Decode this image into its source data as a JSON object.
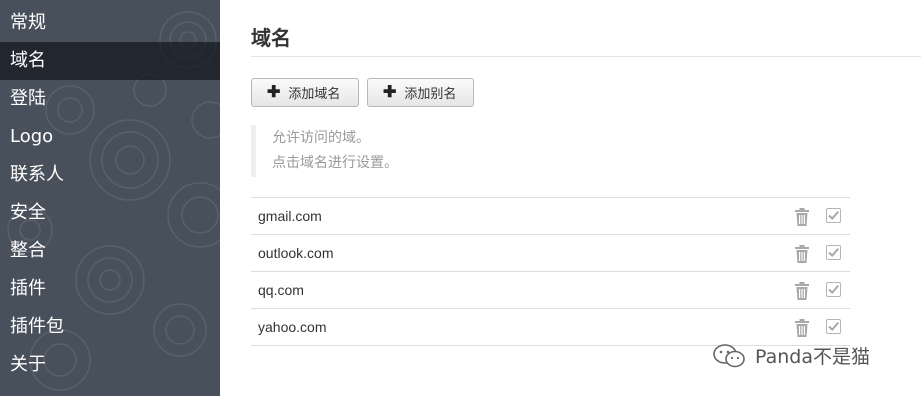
{
  "sidebar": {
    "items": [
      {
        "label": "常规",
        "active": false
      },
      {
        "label": "域名",
        "active": true
      },
      {
        "label": "登陆",
        "active": false
      },
      {
        "label": "Logo",
        "active": false
      },
      {
        "label": "联系人",
        "active": false
      },
      {
        "label": "安全",
        "active": false
      },
      {
        "label": "整合",
        "active": false
      },
      {
        "label": "插件",
        "active": false
      },
      {
        "label": "插件包",
        "active": false
      },
      {
        "label": "关于",
        "active": false
      }
    ]
  },
  "main": {
    "title": "域名",
    "buttons": {
      "add_domain": "添加域名",
      "add_alias": "添加别名"
    },
    "hint": {
      "line1": "允许访问的域。",
      "line2": "点击域名进行设置。"
    },
    "domains": [
      {
        "name": "gmail.com"
      },
      {
        "name": "outlook.com"
      },
      {
        "name": "qq.com"
      },
      {
        "name": "yahoo.com"
      }
    ]
  },
  "watermark": {
    "text": "Panda不是猫"
  },
  "colors": {
    "sidebar_bg": "#48505b",
    "sidebar_active": "#262b33",
    "sidebar_text": "#ffffff",
    "hint_text": "#9a9a9a",
    "icon_gray": "#a8a8a8"
  }
}
